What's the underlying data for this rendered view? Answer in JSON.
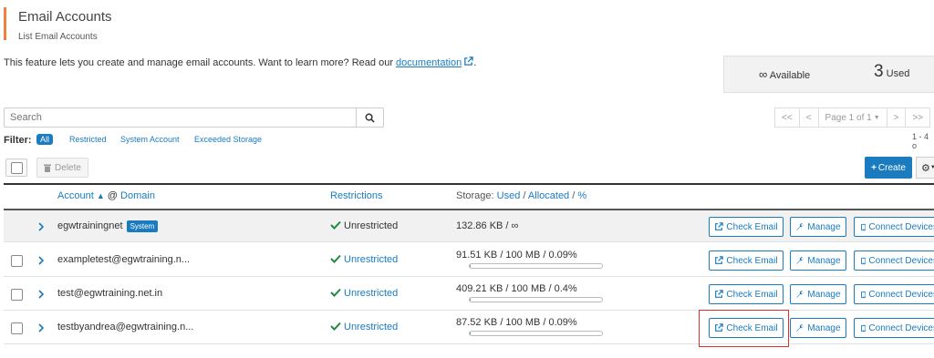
{
  "header": {
    "title": "Email Accounts",
    "subtitle": "List Email Accounts",
    "intro_text": "This feature lets you create and manage email accounts. Want to learn more? Read our ",
    "doc_link": "documentation",
    "intro_tail": "."
  },
  "stats": {
    "available_symbol": "∞",
    "available_label": "Available",
    "used_count": "3",
    "used_label": "Used"
  },
  "search": {
    "placeholder": "Search"
  },
  "pagination": {
    "first": "<<",
    "prev": "<",
    "page_label": "Page 1 of 1",
    "next": ">",
    "last": ">>",
    "range": "1 - 4 o"
  },
  "filter": {
    "label": "Filter:",
    "options": [
      "All",
      "Restricted",
      "System Account",
      "Exceeded Storage"
    ]
  },
  "toolbar": {
    "delete_label": "Delete",
    "create_label": "Create"
  },
  "table": {
    "col_account": "Account",
    "col_at": "@",
    "col_domain": "Domain",
    "col_restrictions": "Restrictions",
    "col_storage_prefix": "Storage:",
    "col_used": "Used",
    "col_allocated": "Allocated",
    "col_percent": "%",
    "rows": [
      {
        "account": "egwtrainingnet",
        "badge": "System",
        "restriction": "Unrestricted",
        "storage": "132.86 KB / ∞",
        "usage_fraction": 0
      },
      {
        "account": "exampletest@egwtraining.n...",
        "restriction": "Unrestricted",
        "storage": "91.51 KB / 100 MB / 0.09%",
        "usage_fraction": 0.0009
      },
      {
        "account": "test@egwtraining.net.in",
        "restriction": "Unrestricted",
        "storage": "409.21 KB / 100 MB / 0.4%",
        "usage_fraction": 0.004
      },
      {
        "account": "testbyandrea@egwtraining.n...",
        "restriction": "Unrestricted",
        "storage": "87.52 KB / 100 MB / 0.09%",
        "usage_fraction": 0.0009
      }
    ],
    "actions": {
      "check_email": "Check Email",
      "manage": "Manage",
      "connect_devices": "Connect Devices"
    }
  },
  "colors": {
    "accent": "#1a7bbf",
    "brand_orange": "#f0803c",
    "highlight": "#d9312b",
    "success": "#1e8a3e"
  }
}
